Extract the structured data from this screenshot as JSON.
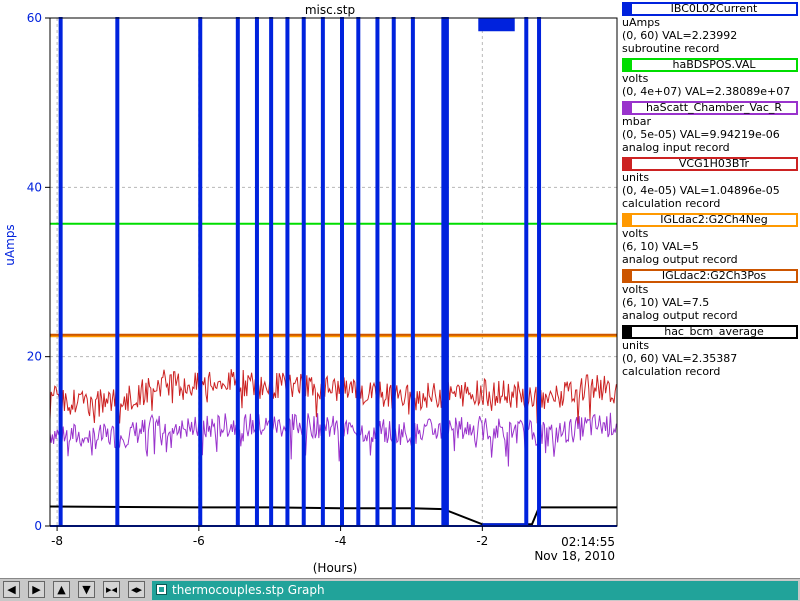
{
  "chart_data": {
    "type": "line",
    "title": "misc.stp",
    "xlabel": "(Hours)",
    "ylabel": "uAmps",
    "xlim": [
      -8.1,
      -0.1
    ],
    "ylim": [
      0,
      60
    ],
    "x_ticks": [
      -8,
      -6,
      -4,
      -2
    ],
    "x_tick_labels": [
      "-8",
      "-6",
      "-4",
      "-2"
    ],
    "y_ticks": [
      0,
      20,
      40,
      60
    ],
    "y_tick_labels": [
      "0",
      "20",
      "40",
      "60"
    ],
    "grid": true,
    "time_label": "02:14:55",
    "date_label": "Nov 18, 2010",
    "series": [
      {
        "name": "IBC0L02Current",
        "color": "#0022dd",
        "x": [
          -8.1,
          -7.9,
          -7.15,
          -6.0,
          -5.45,
          -5.2,
          -5.0,
          -4.75,
          -4.5,
          -4.25,
          -4.0,
          -3.75,
          -3.5,
          -3.25,
          -3.0,
          -2.55,
          -2.0,
          -1.6,
          -1.4,
          -1.2,
          -0.8,
          -0.5,
          -0.3,
          -0.1
        ],
        "y": [
          0,
          0,
          0,
          0,
          0,
          0,
          0,
          0,
          0,
          0,
          0,
          0,
          0,
          0,
          0,
          0,
          60,
          60,
          0,
          0,
          0,
          0,
          0,
          0
        ]
      },
      {
        "name": "haBDSPOS.VAL",
        "color": "#00dd00",
        "x": [
          -8.1,
          -0.1
        ],
        "y": [
          35.7,
          35.7
        ]
      },
      {
        "name": "haScatt_Chamber_Vac_R",
        "color": "#9933cc",
        "x": [
          -8.1,
          -7.5,
          -7.0,
          -6.5,
          -6.0,
          -5.5,
          -5.0,
          -4.5,
          -4.0,
          -3.5,
          -3.0,
          -2.5,
          -2.0,
          -1.5,
          -1.0,
          -0.5,
          -0.1
        ],
        "y": [
          11,
          10.5,
          10.8,
          12,
          11.5,
          12,
          11.8,
          12,
          11.5,
          11.2,
          11,
          11.5,
          11.5,
          11.2,
          10.8,
          11.8,
          12
        ]
      },
      {
        "name": "VCG1H03BTr",
        "color": "#cc2222",
        "x": [
          -8.1,
          -7.5,
          -7.0,
          -6.5,
          -6.0,
          -5.5,
          -5.0,
          -4.5,
          -4.0,
          -3.5,
          -3.0,
          -2.5,
          -2.0,
          -1.5,
          -1.0,
          -0.5,
          -0.1
        ],
        "y": [
          15,
          14.5,
          15,
          17,
          16.5,
          17,
          16.5,
          16.8,
          16,
          15.5,
          15.2,
          15.5,
          15.8,
          15.5,
          15,
          16.5,
          16
        ]
      },
      {
        "name": "IGLdac2:G2Ch4Neg",
        "color": "#ff9900",
        "x": [
          -8.1,
          -0.1
        ],
        "y": [
          22.4,
          22.4
        ]
      },
      {
        "name": "IGLdac2:G2Ch3Pos",
        "color": "#cc5500",
        "x": [
          -8.1,
          -0.1
        ],
        "y": [
          22.6,
          22.6
        ]
      },
      {
        "name": "hac_bcm_average",
        "color": "#000000",
        "x": [
          -8.1,
          -6.0,
          -5.0,
          -4.0,
          -3.0,
          -2.55,
          -2.0,
          -1.3,
          -1.2,
          -1.0,
          -0.5,
          -0.1
        ],
        "y": [
          2.3,
          2.2,
          2.2,
          2.1,
          2.1,
          2.0,
          0.2,
          0.2,
          2.2,
          2.2,
          2.2,
          2.2
        ]
      }
    ]
  },
  "legend": [
    {
      "name": "IBC0L02Current",
      "color": "#0022dd",
      "unit": "uAmps",
      "range": "(0, 60) VAL=2.23992",
      "rtype": "subroutine record"
    },
    {
      "name": "haBDSPOS.VAL",
      "color": "#00dd00",
      "unit": "volts",
      "range": "(0, 4e+07) VAL=2.38089e+07",
      "rtype": ""
    },
    {
      "name": "haScatt_Chamber_Vac_R",
      "color": "#9933cc",
      "unit": "mbar",
      "range": "(0, 5e-05) VAL=9.94219e-06",
      "rtype": "analog input record"
    },
    {
      "name": "VCG1H03BTr",
      "color": "#cc2222",
      "unit": "units",
      "range": "(0, 4e-05) VAL=1.04896e-05",
      "rtype": "calculation record"
    },
    {
      "name": "IGLdac2:G2Ch4Neg",
      "color": "#ff9900",
      "unit": "volts",
      "range": "(6, 10) VAL=5",
      "rtype": "analog output record"
    },
    {
      "name": "IGLdac2:G2Ch3Pos",
      "color": "#cc5500",
      "unit": "volts",
      "range": "(6, 10) VAL=7.5",
      "rtype": "analog output record"
    },
    {
      "name": "hac_bcm_average",
      "color": "#000000",
      "unit": "units",
      "range": "(0, 60) VAL=2.35387",
      "rtype": "calculation record"
    }
  ],
  "bottom": {
    "tab_label": "thermocouples.stp Graph",
    "nav_icons": [
      "arrow-left-icon",
      "arrow-right-icon",
      "arrow-up-icon",
      "arrow-down-icon",
      "zoom-in-icon",
      "zoom-out-icon"
    ]
  }
}
